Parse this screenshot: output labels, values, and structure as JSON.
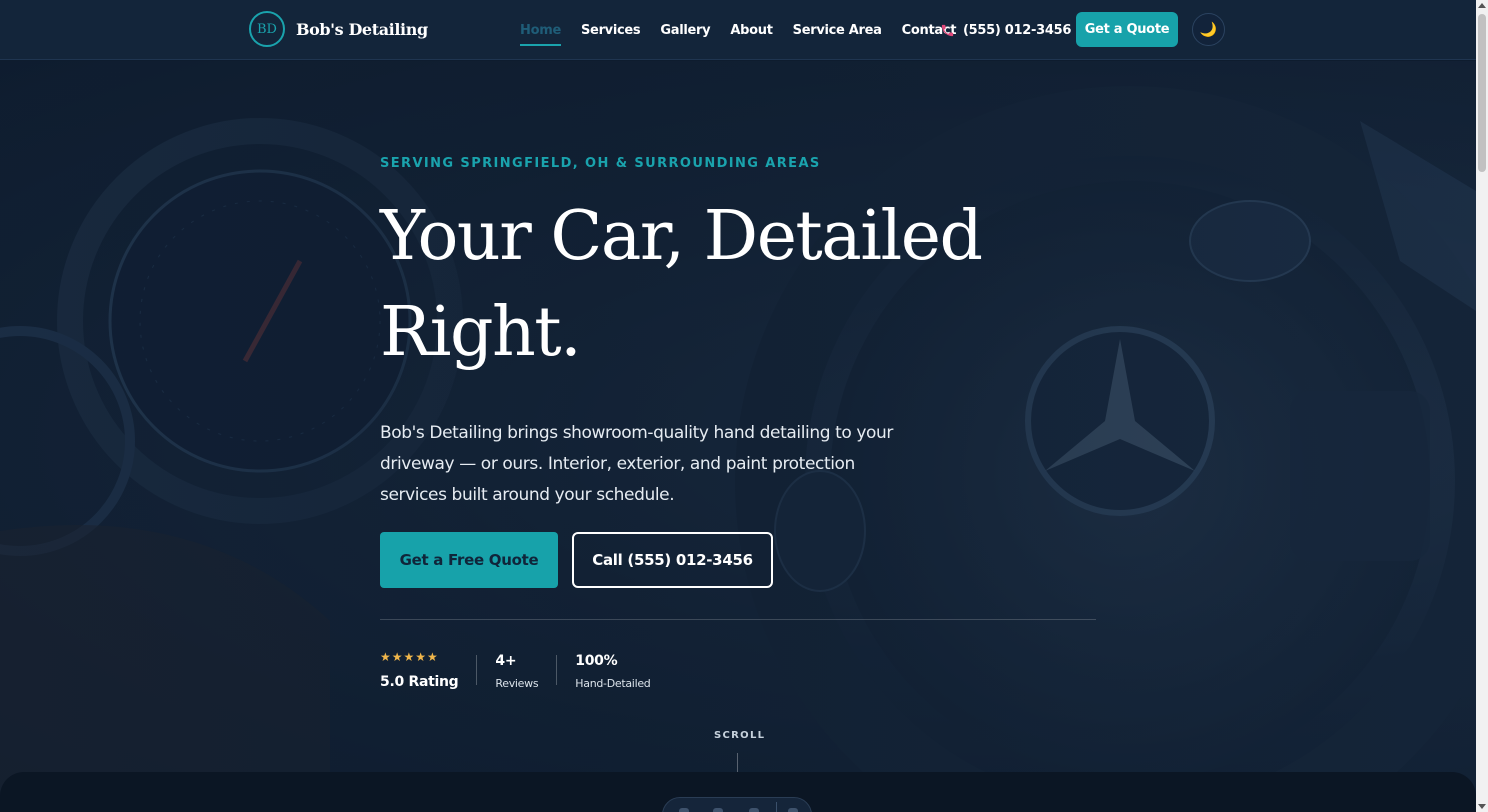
{
  "brand": {
    "initials": "BD",
    "name": "Bob's Detailing"
  },
  "nav": {
    "links": [
      {
        "label": "Home",
        "active": true
      },
      {
        "label": "Services"
      },
      {
        "label": "Gallery"
      },
      {
        "label": "About"
      },
      {
        "label": "Service Area"
      },
      {
        "label": "Contact"
      }
    ],
    "phone": "(555) 012-3456",
    "phone_icon": "phone-icon",
    "cta": "Get a Quote",
    "theme_toggle_icon": "🌙"
  },
  "hero": {
    "eyebrow": "SERVING SPRINGFIELD, OH & SURROUNDING AREAS",
    "title_line1": "Your Car, Detailed",
    "title_line2": "Right.",
    "description": "Bob's Detailing brings showroom-quality hand detailing to your driveway — or ours. Interior, exterior, and paint protection services built around your schedule.",
    "primary_button": "Get a Free Quote",
    "secondary_button": "Call (555) 012-3456",
    "stats": {
      "stars": "★★★★★",
      "rating_label": "5.0 Rating",
      "reviews_value": "4+",
      "reviews_label": "Reviews",
      "hand_value": "100%",
      "hand_label": "Hand-Detailed"
    },
    "scroll_label": "SCROLL"
  },
  "colors": {
    "accent": "#17a2aa",
    "nav_bg": "#13253a",
    "page_bg": "#0e1c2e",
    "star": "#f0b64b",
    "phone_icon": "#e0487a"
  }
}
